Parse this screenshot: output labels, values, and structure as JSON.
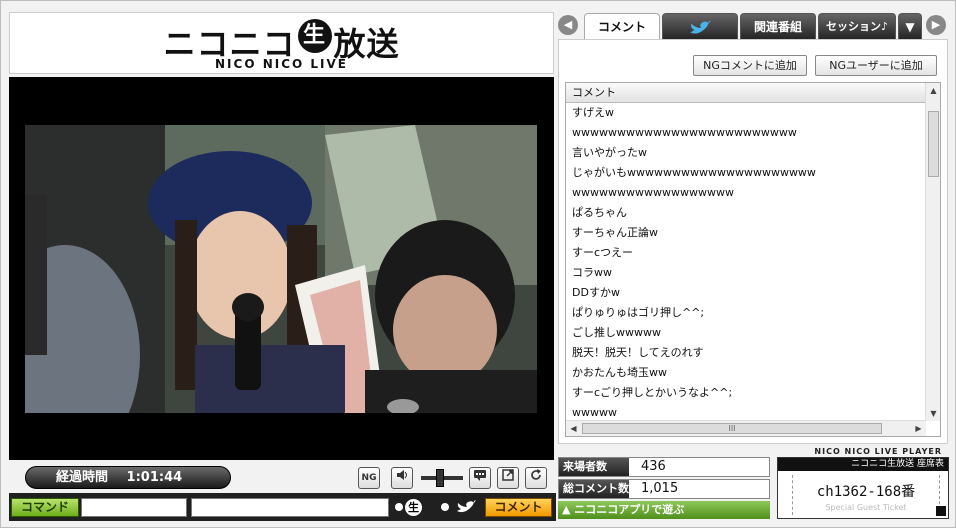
{
  "logo": {
    "main_pre": "ニコニコ",
    "main_circle": "生",
    "main_post": "放送",
    "sub": "NICO NICO LIVE"
  },
  "controls": {
    "elapsed_label": "経過時間",
    "elapsed_time": "1:01:44",
    "ng_button": "NG",
    "command_button": "コマンド",
    "nama_label": "生",
    "send_button": "コメント"
  },
  "tabs": [
    {
      "label": "コメント"
    },
    {
      "label": "twitter"
    },
    {
      "label": "関連番組"
    },
    {
      "label": "セッション♪"
    }
  ],
  "ng": {
    "add_comment": "NGコメントに追加",
    "add_user": "NGユーザーに追加"
  },
  "comment_list": {
    "header": "コメント",
    "rows": [
      "すげえw",
      "wwwwwwwwwwwwwwwwwwwwwwwww",
      "言いやがったw",
      "じゃがいもwwwwwwwwwwwwwwwwwwwww",
      "wwwwwwwwwwwwwwwwww",
      "ぱるちゃん",
      "すーちゃん正論w",
      "すーcつえー",
      "コラww",
      "DDすかw",
      "ぱりゅりゅはゴリ押し^^;",
      "ごし推しwwwww",
      "脱天！脱天！してえのれす",
      "かおたんも埼玉ww",
      "すーcごり押しとかいうなよ^^;",
      "wwwww"
    ],
    "scroll_thumb_label": "III"
  },
  "player_brand": "NICO NICO LIVE PLAYER",
  "stats": {
    "visitors_label": "来場者数",
    "visitors_value": "436",
    "comments_label": "総コメント数",
    "comments_value": "1,015",
    "app_link": "▲ ニコニコアプリで遊ぶ"
  },
  "ticket": {
    "header": "ニコニコ生放送 座席表",
    "seat": "ch1362-168番",
    "footer": "Special Guest Ticket"
  },
  "colors": {
    "command_green": "#6fae1b",
    "send_orange": "#f39a00",
    "app_green": "#4f8f1a"
  }
}
